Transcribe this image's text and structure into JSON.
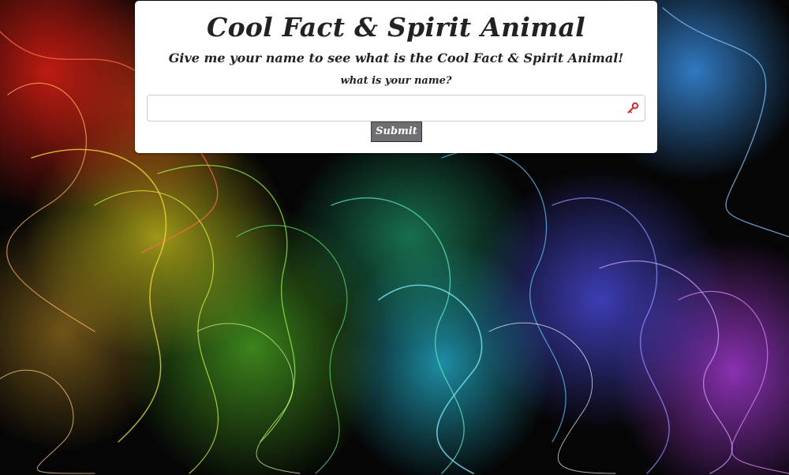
{
  "page": {
    "title": "Cool Fact & Spirit Animal",
    "subtitle": "Give me your name to see what is the Cool Fact & Spirit Animal!",
    "name_label": "what is your name?"
  },
  "form": {
    "name_input": {
      "value": "",
      "placeholder": ""
    },
    "submit_label": "Submit"
  },
  "colors": {
    "card_background": "#ffffff",
    "text": "#222222",
    "submit_background": "#6d6f73",
    "key_icon": "#d0302f"
  },
  "icons": {
    "input_icon": "key-icon",
    "background": "abstract-rainbow-light-streaks"
  }
}
